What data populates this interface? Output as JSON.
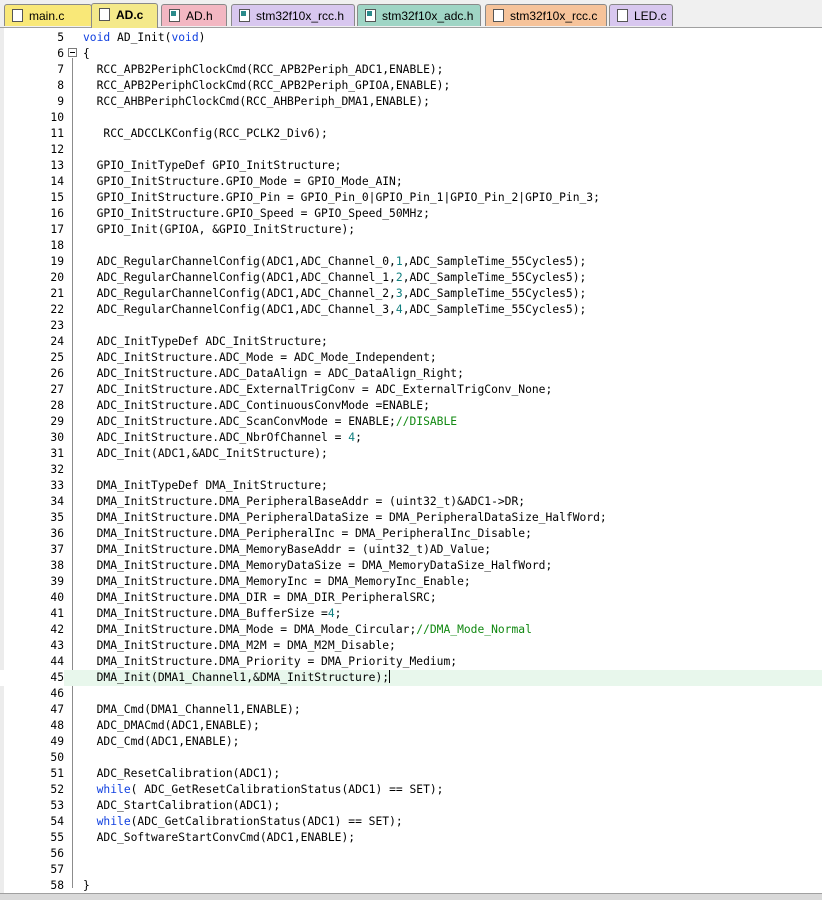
{
  "tabs": [
    {
      "label": "main.c",
      "color": "yellow",
      "kind": "c",
      "active": false
    },
    {
      "label": "AD.c",
      "color": "yellow",
      "kind": "c",
      "active": true
    },
    {
      "label": "AD.h",
      "color": "pink",
      "kind": "h",
      "active": false
    },
    {
      "label": "stm32f10x_rcc.h",
      "color": "purple",
      "kind": "h",
      "active": false
    },
    {
      "label": "stm32f10x_adc.h",
      "color": "green",
      "kind": "h",
      "active": false
    },
    {
      "label": "stm32f10x_rcc.c",
      "color": "orange",
      "kind": "c",
      "active": false
    },
    {
      "label": "LED.c",
      "color": "purple",
      "kind": "c",
      "active": false
    }
  ],
  "editor": {
    "current_line": 45,
    "lines": [
      {
        "n": "5",
        "tokens": [
          {
            "t": "void",
            "c": "kw"
          },
          {
            "t": " AD_Init("
          },
          {
            "t": "void",
            "c": "kw"
          },
          {
            "t": ")"
          }
        ]
      },
      {
        "n": "6",
        "tokens": [
          {
            "t": "{"
          }
        ]
      },
      {
        "n": "7",
        "tokens": [
          {
            "t": "  RCC_APB2PeriphClockCmd(RCC_APB2Periph_ADC1,ENABLE);"
          }
        ]
      },
      {
        "n": "8",
        "tokens": [
          {
            "t": "  RCC_APB2PeriphClockCmd(RCC_APB2Periph_GPIOA,ENABLE);"
          }
        ]
      },
      {
        "n": "9",
        "tokens": [
          {
            "t": "  RCC_AHBPeriphClockCmd(RCC_AHBPeriph_DMA1,ENABLE);"
          }
        ]
      },
      {
        "n": "10",
        "tokens": [
          {
            "t": ""
          }
        ]
      },
      {
        "n": "11",
        "tokens": [
          {
            "t": "   RCC_ADCCLKConfig(RCC_PCLK2_Div6);"
          }
        ]
      },
      {
        "n": "12",
        "tokens": [
          {
            "t": ""
          }
        ]
      },
      {
        "n": "13",
        "tokens": [
          {
            "t": "  GPIO_InitTypeDef GPIO_InitStructure;"
          }
        ]
      },
      {
        "n": "14",
        "tokens": [
          {
            "t": "  GPIO_InitStructure.GPIO_Mode = GPIO_Mode_AIN;"
          }
        ]
      },
      {
        "n": "15",
        "tokens": [
          {
            "t": "  GPIO_InitStructure.GPIO_Pin = GPIO_Pin_0|GPIO_Pin_1|GPIO_Pin_2|GPIO_Pin_3;"
          }
        ]
      },
      {
        "n": "16",
        "tokens": [
          {
            "t": "  GPIO_InitStructure.GPIO_Speed = GPIO_Speed_50MHz;"
          }
        ]
      },
      {
        "n": "17",
        "tokens": [
          {
            "t": "  GPIO_Init(GPIOA, &GPIO_InitStructure);"
          }
        ]
      },
      {
        "n": "18",
        "tokens": [
          {
            "t": ""
          }
        ]
      },
      {
        "n": "19",
        "tokens": [
          {
            "t": "  ADC_RegularChannelConfig(ADC1,ADC_Channel_0,"
          },
          {
            "t": "1",
            "c": "nm"
          },
          {
            "t": ",ADC_SampleTime_55Cycles5);"
          }
        ]
      },
      {
        "n": "20",
        "tokens": [
          {
            "t": "  ADC_RegularChannelConfig(ADC1,ADC_Channel_1,"
          },
          {
            "t": "2",
            "c": "nm"
          },
          {
            "t": ",ADC_SampleTime_55Cycles5);"
          }
        ]
      },
      {
        "n": "21",
        "tokens": [
          {
            "t": "  ADC_RegularChannelConfig(ADC1,ADC_Channel_2,"
          },
          {
            "t": "3",
            "c": "nm"
          },
          {
            "t": ",ADC_SampleTime_55Cycles5);"
          }
        ]
      },
      {
        "n": "22",
        "tokens": [
          {
            "t": "  ADC_RegularChannelConfig(ADC1,ADC_Channel_3,"
          },
          {
            "t": "4",
            "c": "nm"
          },
          {
            "t": ",ADC_SampleTime_55Cycles5);"
          }
        ]
      },
      {
        "n": "23",
        "tokens": [
          {
            "t": ""
          }
        ]
      },
      {
        "n": "24",
        "tokens": [
          {
            "t": "  ADC_InitTypeDef ADC_InitStructure;"
          }
        ]
      },
      {
        "n": "25",
        "tokens": [
          {
            "t": "  ADC_InitStructure.ADC_Mode = ADC_Mode_Independent;"
          }
        ]
      },
      {
        "n": "26",
        "tokens": [
          {
            "t": "  ADC_InitStructure.ADC_DataAlign = ADC_DataAlign_Right;"
          }
        ]
      },
      {
        "n": "27",
        "tokens": [
          {
            "t": "  ADC_InitStructure.ADC_ExternalTrigConv = ADC_ExternalTrigConv_None;"
          }
        ]
      },
      {
        "n": "28",
        "tokens": [
          {
            "t": "  ADC_InitStructure.ADC_ContinuousConvMode =ENABLE;"
          }
        ]
      },
      {
        "n": "29",
        "tokens": [
          {
            "t": "  ADC_InitStructure.ADC_ScanConvMode = ENABLE;"
          },
          {
            "t": "//DISABLE",
            "c": "cm"
          }
        ]
      },
      {
        "n": "30",
        "tokens": [
          {
            "t": "  ADC_InitStructure.ADC_NbrOfChannel = "
          },
          {
            "t": "4",
            "c": "nm"
          },
          {
            "t": ";"
          }
        ]
      },
      {
        "n": "31",
        "tokens": [
          {
            "t": "  ADC_Init(ADC1,&ADC_InitStructure);"
          }
        ]
      },
      {
        "n": "32",
        "tokens": [
          {
            "t": ""
          }
        ]
      },
      {
        "n": "33",
        "tokens": [
          {
            "t": "  DMA_InitTypeDef DMA_InitStructure;"
          }
        ]
      },
      {
        "n": "34",
        "tokens": [
          {
            "t": "  DMA_InitStructure.DMA_PeripheralBaseAddr = (uint32_t)&ADC1->DR;"
          }
        ]
      },
      {
        "n": "35",
        "tokens": [
          {
            "t": "  DMA_InitStructure.DMA_PeripheralDataSize = DMA_PeripheralDataSize_HalfWord;"
          }
        ]
      },
      {
        "n": "36",
        "tokens": [
          {
            "t": "  DMA_InitStructure.DMA_PeripheralInc = DMA_PeripheralInc_Disable;"
          }
        ]
      },
      {
        "n": "37",
        "tokens": [
          {
            "t": "  DMA_InitStructure.DMA_MemoryBaseAddr = (uint32_t)AD_Value;"
          }
        ]
      },
      {
        "n": "38",
        "tokens": [
          {
            "t": "  DMA_InitStructure.DMA_MemoryDataSize = DMA_MemoryDataSize_HalfWord;"
          }
        ]
      },
      {
        "n": "39",
        "tokens": [
          {
            "t": "  DMA_InitStructure.DMA_MemoryInc = DMA_MemoryInc_Enable;"
          }
        ]
      },
      {
        "n": "40",
        "tokens": [
          {
            "t": "  DMA_InitStructure.DMA_DIR = DMA_DIR_PeripheralSRC;"
          }
        ]
      },
      {
        "n": "41",
        "tokens": [
          {
            "t": "  DMA_InitStructure.DMA_BufferSize ="
          },
          {
            "t": "4",
            "c": "nm"
          },
          {
            "t": ";"
          }
        ]
      },
      {
        "n": "42",
        "tokens": [
          {
            "t": "  DMA_InitStructure.DMA_Mode = DMA_Mode_Circular;"
          },
          {
            "t": "//DMA_Mode_Normal",
            "c": "cm"
          }
        ]
      },
      {
        "n": "43",
        "tokens": [
          {
            "t": "  DMA_InitStructure.DMA_M2M = DMA_M2M_Disable;"
          }
        ]
      },
      {
        "n": "44",
        "tokens": [
          {
            "t": "  DMA_InitStructure.DMA_Priority = DMA_Priority_Medium;"
          }
        ]
      },
      {
        "n": "45",
        "tokens": [
          {
            "t": "  DMA_Init(DMA1_Channel1,&DMA_InitStructure);"
          }
        ]
      },
      {
        "n": "46",
        "tokens": [
          {
            "t": ""
          }
        ]
      },
      {
        "n": "47",
        "tokens": [
          {
            "t": "  DMA_Cmd(DMA1_Channel1,ENABLE);"
          }
        ]
      },
      {
        "n": "48",
        "tokens": [
          {
            "t": "  ADC_DMACmd(ADC1,ENABLE);"
          }
        ]
      },
      {
        "n": "49",
        "tokens": [
          {
            "t": "  ADC_Cmd(ADC1,ENABLE);"
          }
        ]
      },
      {
        "n": "50",
        "tokens": [
          {
            "t": ""
          }
        ]
      },
      {
        "n": "51",
        "tokens": [
          {
            "t": "  ADC_ResetCalibration(ADC1);"
          }
        ]
      },
      {
        "n": "52",
        "tokens": [
          {
            "t": "  "
          },
          {
            "t": "while",
            "c": "kw"
          },
          {
            "t": "( ADC_GetResetCalibrationStatus(ADC1) == SET);"
          }
        ]
      },
      {
        "n": "53",
        "tokens": [
          {
            "t": "  ADC_StartCalibration(ADC1);"
          }
        ]
      },
      {
        "n": "54",
        "tokens": [
          {
            "t": "  "
          },
          {
            "t": "while",
            "c": "kw"
          },
          {
            "t": "(ADC_GetCalibrationStatus(ADC1) == SET);"
          }
        ]
      },
      {
        "n": "55",
        "tokens": [
          {
            "t": "  ADC_SoftwareStartConvCmd(ADC1,ENABLE);"
          }
        ]
      },
      {
        "n": "56",
        "tokens": [
          {
            "t": ""
          }
        ]
      },
      {
        "n": "57",
        "tokens": [
          {
            "t": ""
          }
        ]
      },
      {
        "n": "58",
        "tokens": [
          {
            "t": "}"
          }
        ]
      }
    ]
  }
}
